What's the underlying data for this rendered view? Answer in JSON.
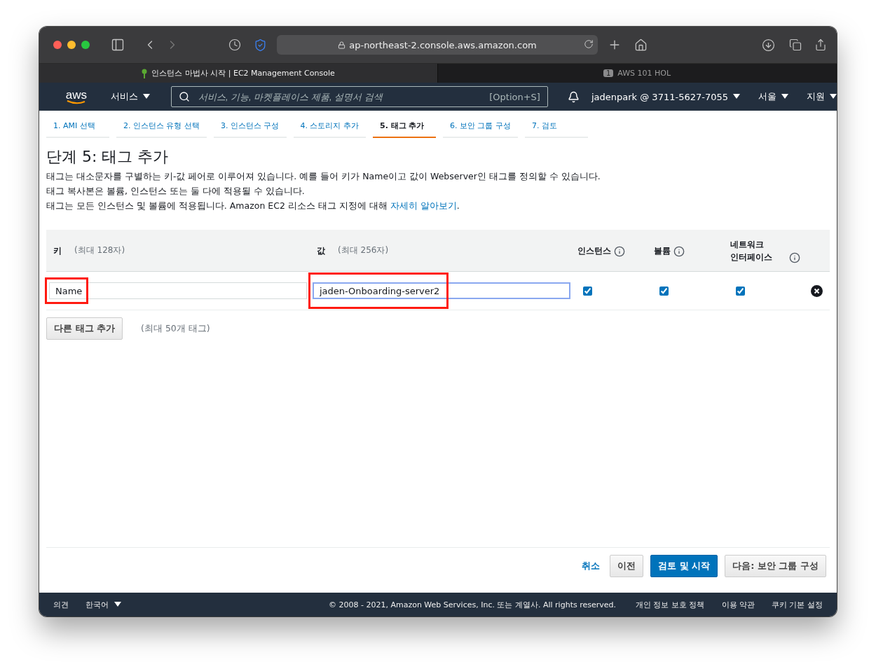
{
  "browser": {
    "url": "ap-northeast-2.console.aws.amazon.com",
    "tabs": [
      {
        "title": "인스턴스 마법사 시작 | EC2 Management Console",
        "selected": true
      },
      {
        "title": "AWS 101 HOL",
        "badge": "1",
        "selected": false
      }
    ]
  },
  "aws_nav": {
    "logo": "aws",
    "services": "서비스",
    "search_placeholder": "서비스, 기능, 마켓플레이스 제품, 설명서 검색",
    "shortcut": "[Option+S]",
    "account": "jadenpark @ 3711-5627-7055",
    "region": "서울",
    "support": "지원"
  },
  "wizard_steps": [
    {
      "label": "1. AMI 선택",
      "selected": false
    },
    {
      "label": "2. 인스턴스 유형 선택",
      "selected": false
    },
    {
      "label": "3. 인스턴스 구성",
      "selected": false
    },
    {
      "label": "4. 스토리지 추가",
      "selected": false
    },
    {
      "label": "5. 태그 추가",
      "selected": true
    },
    {
      "label": "6. 보안 그룹 구성",
      "selected": false
    },
    {
      "label": "7. 검토",
      "selected": false
    }
  ],
  "heading": "단계 5: 태그 추가",
  "description": [
    "태그는 대소문자를 구별하는 키-값 페어로 이루어져 있습니다. 예를 들어 키가 Name이고 값이 Webserver인 태그를 정의할 수 있습니다.",
    "태그 복사본은 볼륨, 인스턴스 또는 둘 다에 적용될 수 있습니다."
  ],
  "note": {
    "text": "태그는 모든 인스턴스 및 볼륨에 적용됩니다. Amazon EC2 리소스 태그 지정에 대해",
    "link": "자세히 알아보기",
    "end": "."
  },
  "tags_table": {
    "columns": [
      {
        "label": "키",
        "hint": "(최대 128자)",
        "kind": "text"
      },
      {
        "label": "값",
        "hint": "(최대 256자)",
        "kind": "text"
      },
      {
        "label": "인스턴스",
        "kind": "check"
      },
      {
        "label": "볼륨",
        "kind": "check"
      },
      {
        "label": "네트워크 인터페이스",
        "kind": "check"
      }
    ],
    "rows": [
      {
        "key": "Name",
        "key_highlighted": true,
        "value": "jaden-Onboarding-server2",
        "value_highlighted": true,
        "value_focused": true,
        "instances": true,
        "volumes": true,
        "network_interfaces": true
      }
    ]
  },
  "add_tag_button": "다른 태그 추가",
  "add_tag_hint": "(최대 50개 태그)",
  "actions": {
    "cancel": "취소",
    "buttons": [
      {
        "label": "이전",
        "kind": "secondary"
      },
      {
        "label": "검토 및 시작",
        "kind": "primary"
      },
      {
        "label": "다음: 보안 그룹 구성",
        "kind": "secondary"
      }
    ]
  },
  "footer": {
    "feedback": "의견",
    "language": "한국어",
    "copyright": "© 2008 - 2021, Amazon Web Services, Inc. 또는 계열사. All rights reserved.",
    "links": [
      "개인 정보 보호 정책",
      "이용 약관",
      "쿠키 기본 설정"
    ]
  }
}
